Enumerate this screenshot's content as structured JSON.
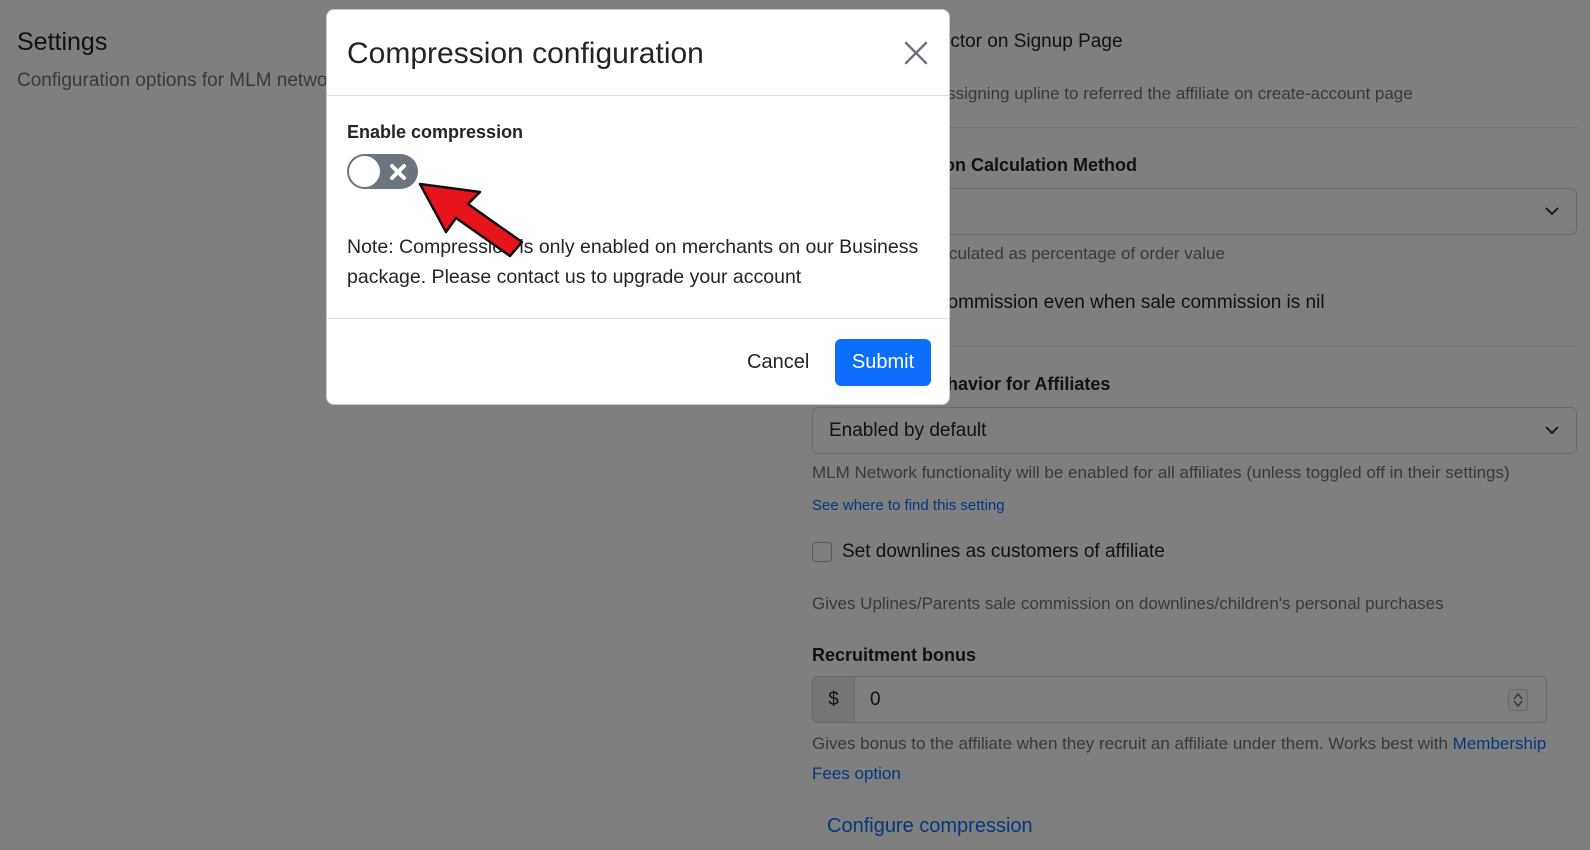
{
  "page": {
    "title": "Settings",
    "subtitle": "Configuration options for MLM network"
  },
  "settings": {
    "signup_label": "Show MLM Selector on Signup Page",
    "signup_help": "Allows selecting/assigning upline to referred the affiliate on create-account page",
    "calc_method_label": "MLM Commission Calculation Method",
    "calc_method_value": "",
    "calc_method_help": "Commission is calculated as percentage of order value",
    "nil_label": "Give MLM Commission even when sale commission is nil",
    "default_label": "MLM Default Behavior for Affiliates",
    "default_value": "Enabled by default",
    "default_help": "MLM Network functionality will be enabled for all affiliates (unless toggled off in their settings)",
    "default_link": "See where to find this setting",
    "downlines_label": "Set downlines as customers of affiliate",
    "downlines_help": "Gives Uplines/Parents sale commission on downlines/children's personal purchases",
    "recruit_label": "Recruitment bonus",
    "recruit_currency": "$",
    "recruit_value": "0",
    "recruit_help": "Gives bonus to the affiliate when they recruit an affiliate under them. Works best with ",
    "recruit_help_link": "Membership Fees option",
    "configure_link": "Configure compression"
  },
  "modal": {
    "title": "Compression configuration",
    "enable_label": "Enable compression",
    "toggle_state": "off",
    "note": "Note: Compression is only enabled on merchants on our Business package. Please contact us to upgrade your account",
    "cancel_label": "Cancel",
    "submit_label": "Submit"
  },
  "colors": {
    "primary": "#0d6efd",
    "toggle_off": "#6c757d",
    "arrow": "#e8141c"
  },
  "icons": {
    "close": "close-icon",
    "toggle_off": "x-mark-icon",
    "select": "chevron-down-icon",
    "annotation": "red-arrow-pointer"
  }
}
